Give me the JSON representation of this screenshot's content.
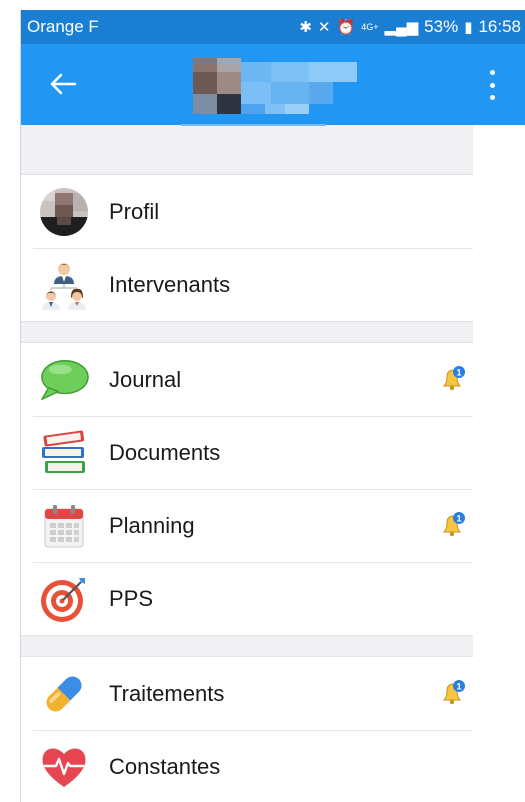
{
  "status_bar": {
    "carrier": "Orange F",
    "network": "4G+",
    "battery": "53%",
    "time": "16:58",
    "icons": [
      "bluetooth-icon",
      "mute-icon",
      "alarm-icon",
      "signal-icon",
      "battery-icon"
    ]
  },
  "app_bar": {
    "back_icon": "arrow-left-icon",
    "menu_icon": "more-vertical-icon"
  },
  "sections": [
    {
      "items": [
        {
          "label": "Profil",
          "icon": "avatar-photo",
          "notification": false
        },
        {
          "label": "Intervenants",
          "icon": "team-icon",
          "notification": false
        }
      ]
    },
    {
      "items": [
        {
          "label": "Journal",
          "icon": "speech-bubble-icon",
          "notification": true,
          "badge": "1"
        },
        {
          "label": "Documents",
          "icon": "books-icon",
          "notification": false
        },
        {
          "label": "Planning",
          "icon": "calendar-icon",
          "notification": true,
          "badge": "1"
        },
        {
          "label": "PPS",
          "icon": "target-icon",
          "notification": false
        }
      ]
    },
    {
      "items": [
        {
          "label": "Traitements",
          "icon": "pill-icon",
          "notification": true,
          "badge": "1"
        },
        {
          "label": "Constantes",
          "icon": "heart-pulse-icon",
          "notification": false
        }
      ]
    }
  ],
  "colors": {
    "status_bar": "#1a7fd3",
    "app_bar": "#2196f3",
    "section_gap": "#f1f1f3",
    "bell": "#f5c542",
    "badge": "#2a7de1"
  }
}
